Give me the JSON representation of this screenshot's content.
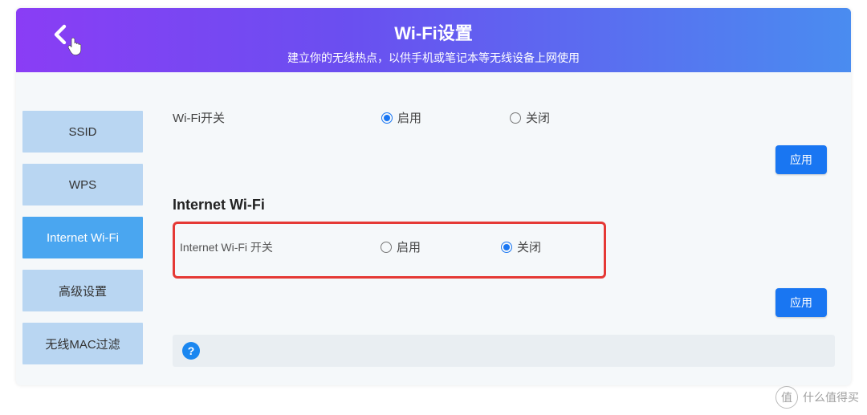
{
  "header": {
    "title": "Wi-Fi设置",
    "subtitle": "建立你的无线热点，以供手机或笔记本等无线设备上网使用"
  },
  "sidebar": {
    "items": [
      {
        "label": "SSID",
        "active": false
      },
      {
        "label": "WPS",
        "active": false
      },
      {
        "label": "Internet Wi-Fi",
        "active": true
      },
      {
        "label": "高级设置",
        "active": false
      },
      {
        "label": "无线MAC过滤",
        "active": false
      }
    ]
  },
  "wifi_section": {
    "label": "Wi-Fi开关",
    "option_enable": "启用",
    "option_disable": "关闭",
    "selected": "enable"
  },
  "internet_section": {
    "heading": "Internet Wi-Fi",
    "label": "Internet Wi-Fi 开关",
    "option_enable": "启用",
    "option_disable": "关闭",
    "selected": "disable"
  },
  "buttons": {
    "apply": "应用"
  },
  "help": {
    "icon_text": "?"
  },
  "watermark": {
    "badge": "值",
    "text": "什么值得买"
  }
}
